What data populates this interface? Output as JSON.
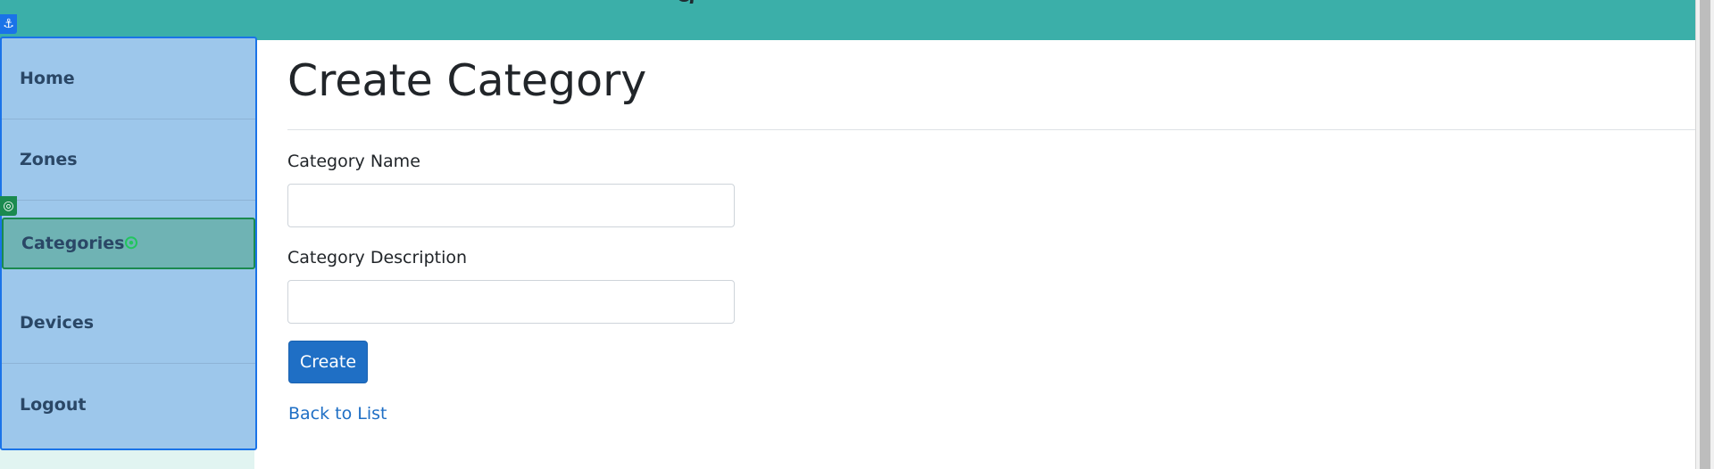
{
  "header": {
    "title_fragment": "g",
    "background_color": "#3bafa9"
  },
  "sidebar": {
    "items": [
      {
        "label": "Home",
        "active": false
      },
      {
        "label": "Zones",
        "active": false
      },
      {
        "label": "Categories",
        "active": true
      },
      {
        "label": "Devices",
        "active": false
      },
      {
        "label": "Logout",
        "active": false
      }
    ],
    "background_color": "#9dc7eb",
    "active_color": "#6fb3b4"
  },
  "overlay_badges": {
    "anchor_icon": "anchor-icon",
    "target_icon": "target-icon"
  },
  "main": {
    "page_title": "Create Category",
    "fields": [
      {
        "label": "Category Name",
        "value": "",
        "placeholder": ""
      },
      {
        "label": "Category Description",
        "value": "",
        "placeholder": ""
      }
    ],
    "create_label": "Create",
    "back_link_label": "Back to List",
    "primary_color": "#1f6fc5"
  }
}
